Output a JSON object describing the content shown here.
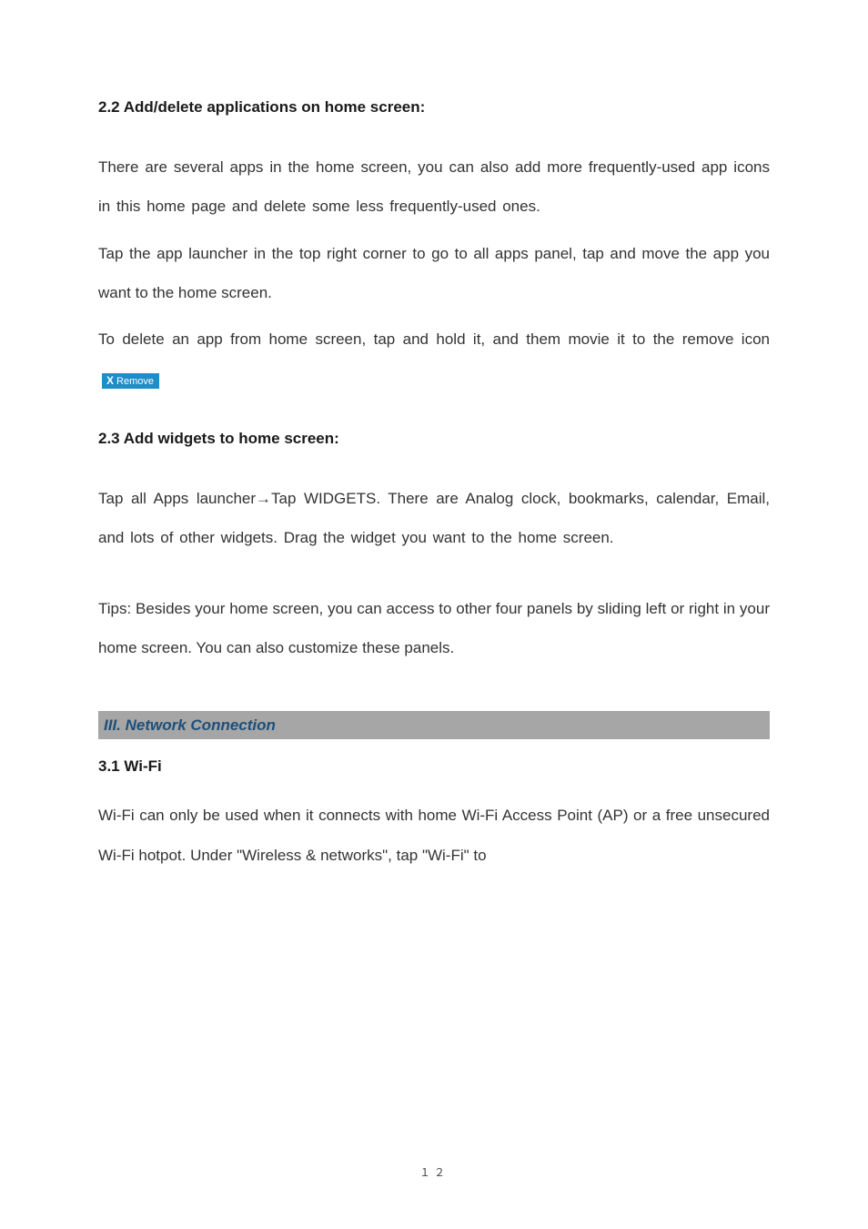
{
  "sec22": {
    "heading": "2.2 Add/delete applications on home screen:",
    "p1": "There are several apps in the home screen, you can also add more frequently-used app icons in this home page and delete some less frequently-used ones.",
    "p2": "Tap the app launcher in the top right corner to go to all apps panel, tap and move the app you want to the home screen.",
    "p3a": "To delete an app from home screen, tap and hold it, and them movie it to the remove icon ",
    "remove_x": "X",
    "remove_label": "Remove"
  },
  "sec23": {
    "heading": "2.3 Add widgets to home screen:",
    "p1": "Tap all Apps launcher→Tap WIDGETS. There are Analog clock, bookmarks, calendar, Email, and lots of other widgets. Drag the widget you want to the home screen.",
    "tips": "Tips: Besides your home screen, you can access to other four panels by sliding left or right in your home screen. You can also customize these panels."
  },
  "chapter3": {
    "title": "III. Network Connection"
  },
  "sec31": {
    "heading": "3.1 Wi-Fi",
    "p1": "Wi-Fi can only be used when it connects with home Wi-Fi Access Point (AP) or a free unsecured Wi-Fi hotpot. Under \"Wireless & networks\", tap \"Wi-Fi\" to"
  },
  "footer": {
    "page": "１２"
  }
}
